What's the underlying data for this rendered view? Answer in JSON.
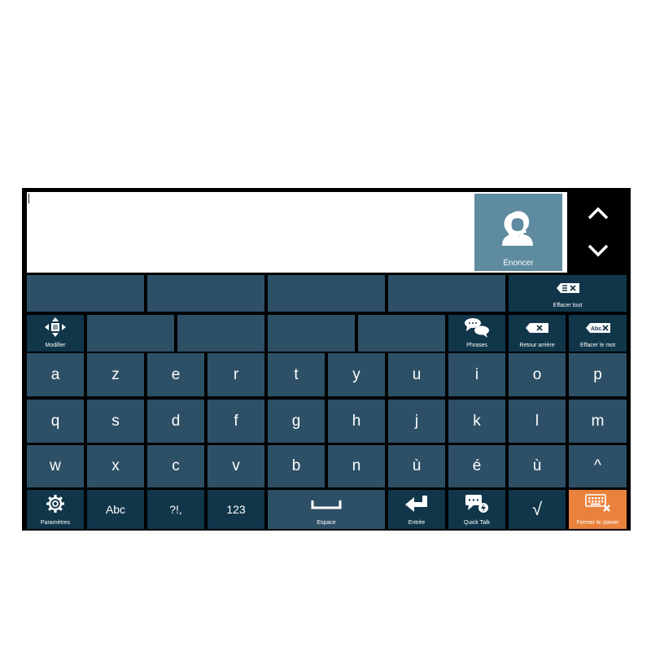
{
  "speak": {
    "label": "Énoncer"
  },
  "row1_right": {
    "label": "Effacer tout"
  },
  "row2": {
    "modify": "Modifier",
    "phrases": "Phrases",
    "backspace": "Retour arrière",
    "delete_word": "Effacer le mot",
    "delete_word_icon_text": "Abc"
  },
  "letters": {
    "row3": [
      "a",
      "z",
      "e",
      "r",
      "t",
      "y",
      "u",
      "i",
      "o",
      "p"
    ],
    "row4": [
      "q",
      "s",
      "d",
      "f",
      "g",
      "h",
      "j",
      "k",
      "l",
      "m"
    ],
    "row5": [
      "w",
      "x",
      "c",
      "v",
      "b",
      "n",
      "ù",
      "é",
      "ù",
      "^"
    ]
  },
  "bottom": {
    "settings": "Paramètres",
    "abc": "Abc",
    "punct": "?!,",
    "numbers": "123",
    "space": "Espace",
    "enter": "Entrée",
    "quick_talk": "Quick Talk",
    "check": "√",
    "close_keyboard": "Fermer le clavier"
  },
  "colors": {
    "key": "#2d5066",
    "key_dark": "#11364a",
    "speak": "#5f8ba0",
    "close": "#e9823c",
    "frame": "#000000"
  }
}
